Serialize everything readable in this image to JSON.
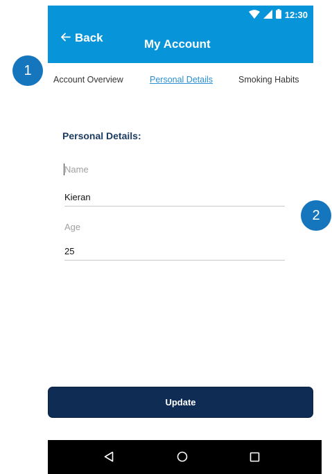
{
  "status_bar": {
    "time": "12:30",
    "icons": [
      "wifi-icon",
      "cell-signal-icon",
      "battery-icon"
    ]
  },
  "header": {
    "back_label": "Back",
    "title": "My Account"
  },
  "tabs": [
    {
      "label": "Account Overview",
      "active": false
    },
    {
      "label": "Personal Details",
      "active": true
    },
    {
      "label": "Smoking Habits",
      "active": false
    }
  ],
  "callouts": [
    "1",
    "2"
  ],
  "form": {
    "section_title": "Personal Details:",
    "name": {
      "label": "Name",
      "value": "Kieran"
    },
    "age": {
      "label": "Age",
      "value": "25"
    }
  },
  "actions": {
    "update_label": "Update"
  },
  "nav": {
    "icons": [
      "back-triangle-icon",
      "home-circle-icon",
      "recents-square-icon"
    ]
  },
  "colors": {
    "header_bg": "#0794d8",
    "callout_bg": "#1676bd",
    "button_bg": "#0f2d54",
    "active_tab": "#2a8fd0",
    "section_title": "#1b3a5e"
  }
}
